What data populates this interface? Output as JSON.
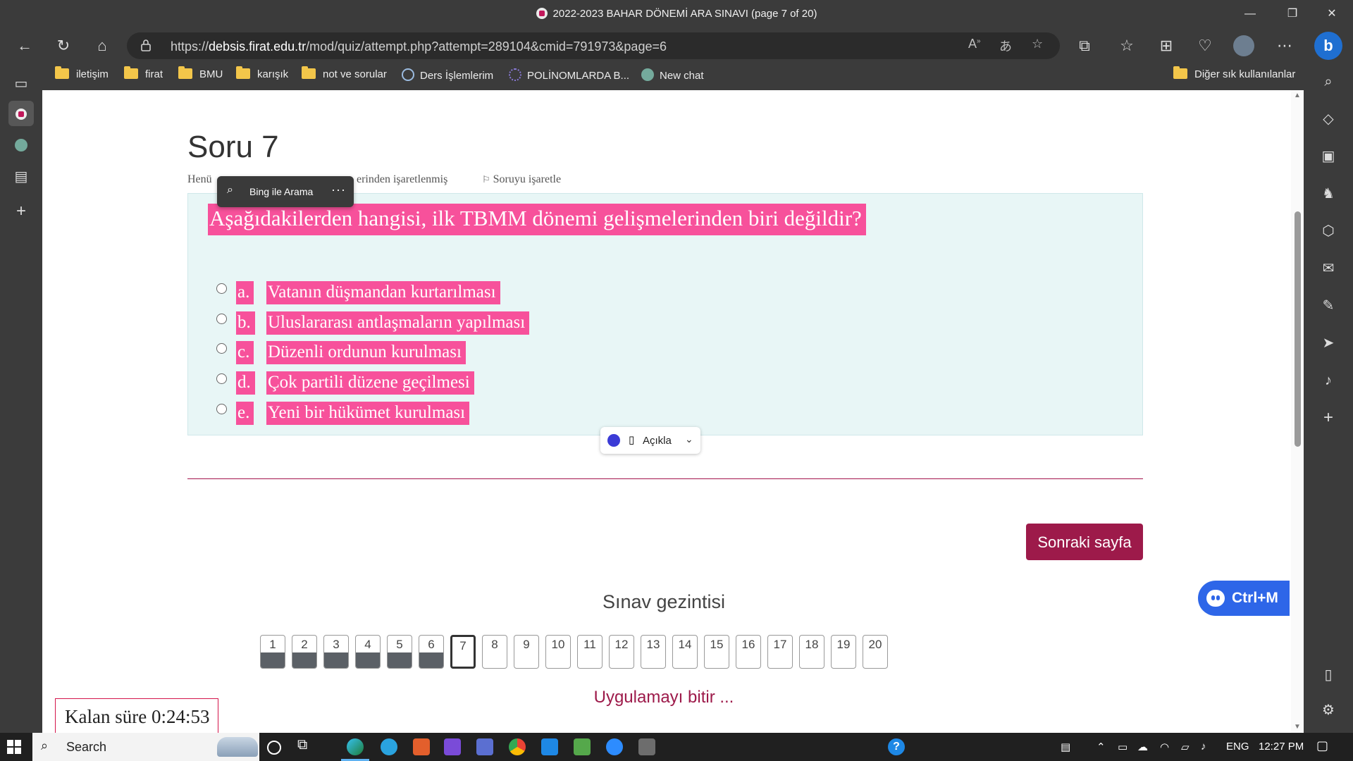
{
  "window": {
    "title": "2022-2023 BAHAR DÖNEMİ ARA SINAVI (page 7 of 20)",
    "minimize": "—",
    "maximize": "❐",
    "close": "✕"
  },
  "address_bar": {
    "url_prefix": "https://",
    "url_domain": "debsis.firat.edu.tr",
    "url_path": "/mod/quiz/attempt.php?attempt=289104&cmid=791973&page=6"
  },
  "bookmarks": [
    {
      "label": "iletişim",
      "icon": "folder-icon"
    },
    {
      "label": "firat",
      "icon": "folder-icon"
    },
    {
      "label": "BMU",
      "icon": "folder-icon"
    },
    {
      "label": "karışık",
      "icon": "folder-icon"
    },
    {
      "label": "not ve sorular",
      "icon": "folder-icon"
    },
    {
      "label": "Ders İşlemlerim",
      "icon": "site-icon"
    },
    {
      "label": "POLİNOMLARDA B...",
      "icon": "site-icon"
    },
    {
      "label": "New chat",
      "icon": "chatgpt-icon"
    }
  ],
  "other_favorites": "Diğer sık kullanılanlar",
  "quiz": {
    "heading": "Soru 7",
    "status_prefix": "Henü",
    "status_suffix": "erinden işaretlenmiş",
    "flag_label": "Soruyu işaretle",
    "question": "Aşağıdakilerden hangisi, ilk TBMM dönemi gelişmelerinden biri değildir?",
    "options": [
      {
        "letter": "a.",
        "text": "Vatanın düşmandan kurtarılması"
      },
      {
        "letter": "b.",
        "text": "Uluslararası antlaşmaların yapılması"
      },
      {
        "letter": "c.",
        "text": "Düzenli ordunun kurulması"
      },
      {
        "letter": "d.",
        "text": "Çok partili düzene geçilmesi"
      },
      {
        "letter": "e.",
        "text": "Yeni bir hükümet kurulması"
      }
    ],
    "next_button": "Sonraki sayfa",
    "navigation_title": "Sınav gezintisi",
    "nav_buttons": [
      "1",
      "2",
      "3",
      "4",
      "5",
      "6",
      "7",
      "8",
      "9",
      "10",
      "11",
      "12",
      "13",
      "14",
      "15",
      "16",
      "17",
      "18",
      "19",
      "20"
    ],
    "answered_count": 6,
    "current_question": 7,
    "finish_link": "Uygulamayı bitir ...",
    "timer": "Kalan süre 0:24:53"
  },
  "popups": {
    "bing_search": "Bing ile Arama",
    "bing_more": "···",
    "explain": "Açıkla",
    "shortcut": "Ctrl+M"
  },
  "taskbar": {
    "search_placeholder": "Search",
    "language": "ENG",
    "time": "12:27 PM"
  },
  "colors": {
    "highlight": "#f7519b",
    "question_bg": "#e8f6f6",
    "brand": "#9d1a4a",
    "chrome": "#3b3b3b"
  }
}
